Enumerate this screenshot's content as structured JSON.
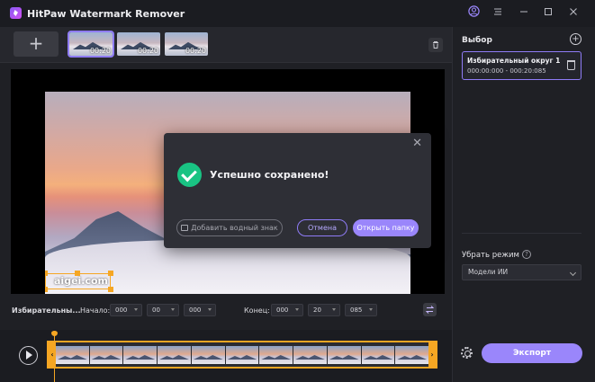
{
  "app": {
    "title": "HitPaw Watermark Remover"
  },
  "titlebar": {
    "icons": [
      "user-icon",
      "menu-icon",
      "minimize-icon",
      "maximize-icon",
      "close-icon"
    ]
  },
  "media": {
    "add_label": "+",
    "thumbnails": [
      {
        "duration": "00:20",
        "active": true
      },
      {
        "duration": "00:20",
        "active": false
      },
      {
        "duration": "00:20",
        "active": false
      }
    ]
  },
  "preview": {
    "watermark_text": "aigei.com"
  },
  "dialog": {
    "message": "Успешно сохранено!",
    "add_watermark_label": "Добавить водный знак",
    "cancel_label": "Отмена",
    "open_folder_label": "Открыть папку"
  },
  "timerow": {
    "region_label": "Избирательны...",
    "start_label": "Начало:",
    "start": {
      "h": "000",
      "m": "00",
      "s": "000"
    },
    "end_label": "Конец:",
    "end": {
      "h": "000",
      "m": "20",
      "s": "085"
    }
  },
  "sidebar": {
    "title": "Выбор",
    "selection": {
      "name": "Избирательный округ 1",
      "time": "000:00:000 - 000:20:085"
    },
    "mode_label": "Убрать режим",
    "mode_help": "?",
    "mode_value": "Модели ИИ",
    "export_label": "Экспорт"
  },
  "colors": {
    "accent": "#9a86fb",
    "success": "#19c383",
    "selection": "#f5a623"
  }
}
